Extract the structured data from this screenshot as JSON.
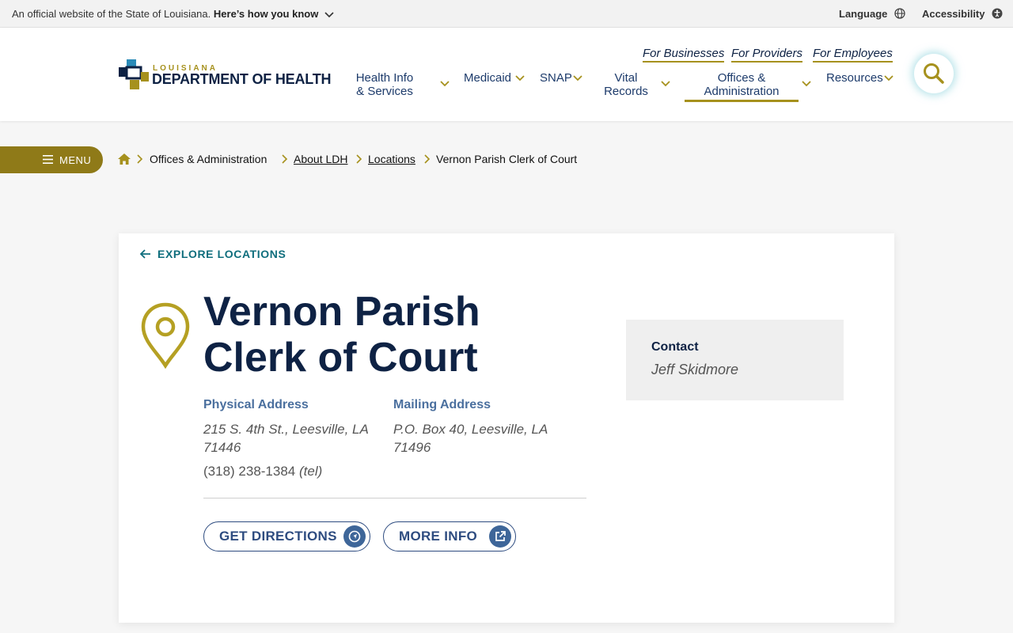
{
  "gov_banner": {
    "official_text": "An official website of the State of Louisiana.",
    "how_you_know": "Here’s how you know",
    "language": "Language",
    "accessibility": "Accessibility"
  },
  "logo": {
    "line1": "LOUISIANA",
    "line2": "DEPARTMENT OF HEALTH"
  },
  "audience_links": [
    "For Businesses",
    "For Providers",
    "For Employees"
  ],
  "nav": {
    "health_info_1": "Health Info",
    "health_info_2": "& Services",
    "medicaid": "Medicaid",
    "snap": "SNAP",
    "vital_1": "Vital",
    "vital_2": "Records",
    "offices_1": "Offices &",
    "offices_2": "Administration",
    "resources": "Resources"
  },
  "menu_label": "MENU",
  "breadcrumb": [
    "Offices & Administration",
    "About LDH",
    "Locations",
    "Vernon Parish Clerk of Court"
  ],
  "back_link": "EXPLORE LOCATIONS",
  "location": {
    "title_line1": "Vernon Parish",
    "title_line2": "Clerk of Court",
    "physical_label": "Physical Address",
    "physical_line1": "215 S. 4th St., Leesville, LA",
    "physical_line2": "71446",
    "mailing_label": "Mailing Address",
    "mailing_line1": "P.O. Box 40, Leesville, LA",
    "mailing_line2": "71496",
    "phone": "(318) 238-1384",
    "phone_note": "(tel)"
  },
  "buttons": {
    "directions": "GET DIRECTIONS",
    "more_info": "MORE INFO"
  },
  "contact": {
    "label": "Contact",
    "name": "Jeff Skidmore"
  },
  "colors": {
    "navy": "#0e2244",
    "gold": "#a6911d",
    "teal": "#0f6e7d",
    "blue": "#2e4c80"
  }
}
